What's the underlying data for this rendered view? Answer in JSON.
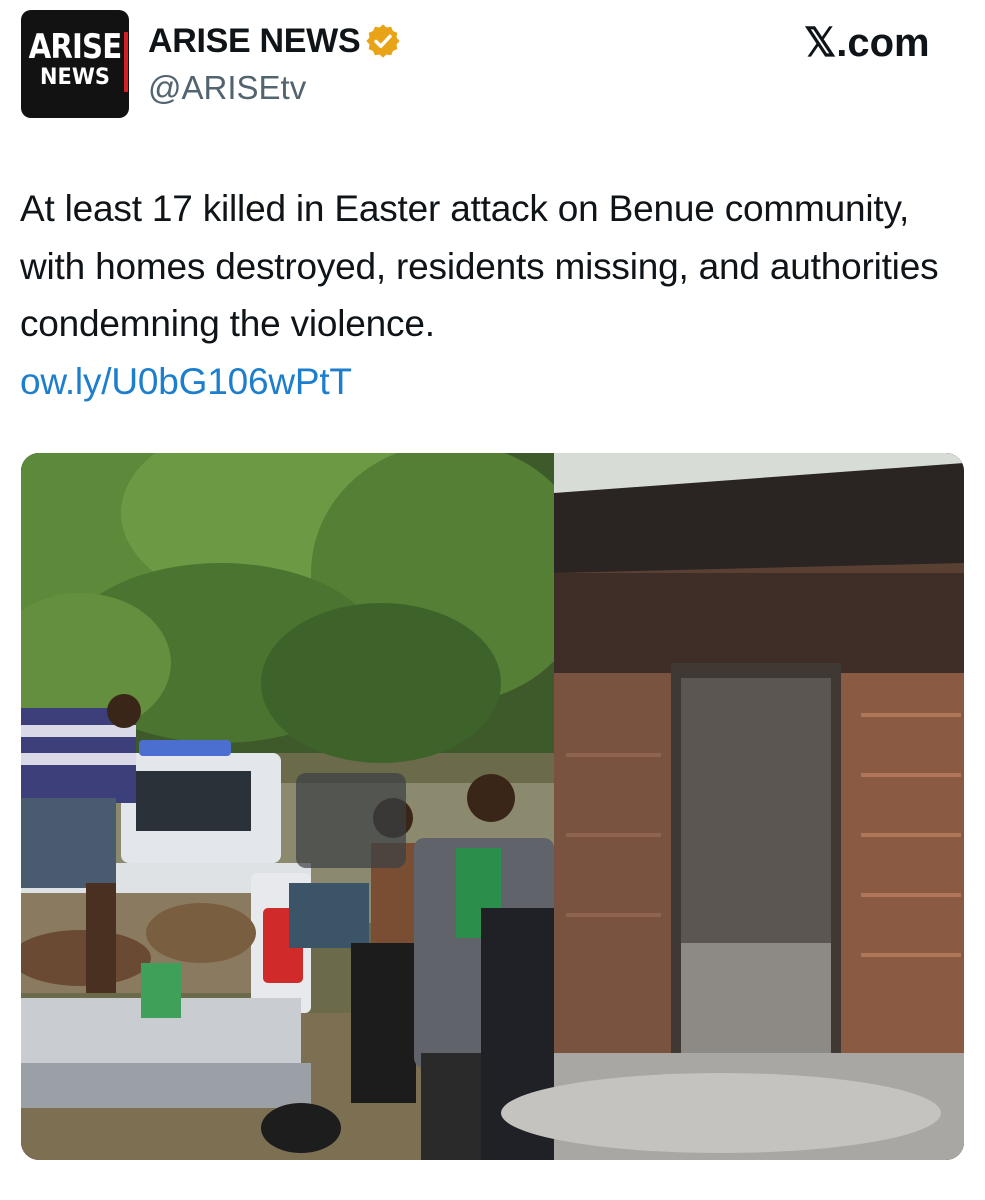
{
  "account": {
    "avatar_line1": "ARISE",
    "avatar_line2": "NEWS",
    "display_name": "ARISE NEWS",
    "handle": "@ARISEtv",
    "verified_icon": "gold-verified-badge-icon"
  },
  "brand": {
    "label": "𝕏.com"
  },
  "tweet": {
    "text": "At least 17 killed in Easter attack on Benue community, with homes destroyed, residents missing, and authorities condemning the violence.",
    "link": "ow.ly/U0bG106wPtT"
  },
  "colors": {
    "link": "#1d7ecd",
    "badge": "#e8a317",
    "avatar_bg": "#121212",
    "avatar_accent": "#d32027"
  }
}
